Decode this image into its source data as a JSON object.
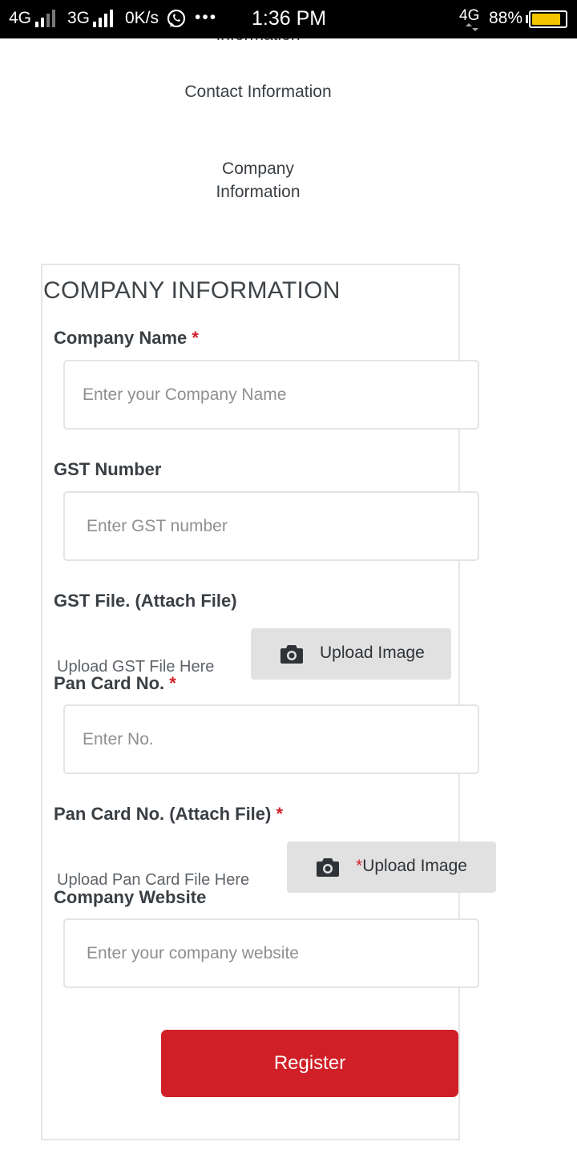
{
  "status_bar": {
    "network1": "4G",
    "network2": "3G",
    "speed": "0K/s",
    "more": "•••",
    "time": "1:36 PM",
    "network3": "4G",
    "battery": "88%",
    "battery_level": 0.88,
    "battery_color": "#f5c400"
  },
  "steps": {
    "partial": "Information",
    "contact": "Contact Information",
    "company": "Company Information"
  },
  "form": {
    "title": "COMPANY INFORMATION",
    "required_mark": "*",
    "company_name": {
      "label": "Company Name",
      "placeholder": "Enter your Company Name"
    },
    "gst_number": {
      "label": "GST Number",
      "placeholder": "Enter GST number"
    },
    "gst_file": {
      "label": "GST File. (Attach File)",
      "hint": "Upload GST File Here",
      "button": "Upload Image"
    },
    "pan_card": {
      "label": "Pan Card No.",
      "placeholder": "Enter No."
    },
    "pan_file": {
      "label": "Pan Card No. (Attach File)",
      "hint": "Upload Pan Card File Here",
      "button": "Upload Image"
    },
    "website": {
      "label": "Company Website",
      "placeholder": "Enter your company website"
    },
    "register": "Register"
  },
  "colors": {
    "accent": "#d01f26",
    "upload_bg": "#e1e1e1"
  }
}
